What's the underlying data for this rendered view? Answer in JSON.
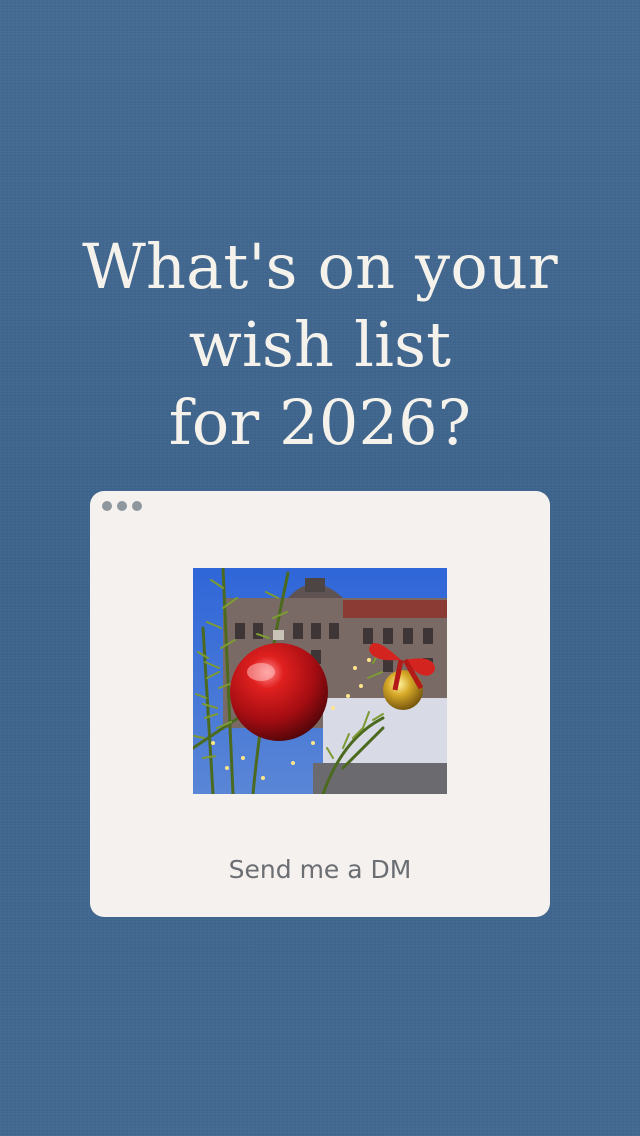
{
  "background_color": "#3f6690",
  "headline": {
    "line1": "What's on your",
    "line2": "wish list",
    "line3": "for 2026?"
  },
  "card": {
    "background_color": "#f5f1ee",
    "cta_label": "Send me a DM",
    "window_controls": [
      "dot",
      "dot",
      "dot"
    ],
    "photo_subject": "red-and-gold-christmas-ornaments-on-pine-branches"
  }
}
